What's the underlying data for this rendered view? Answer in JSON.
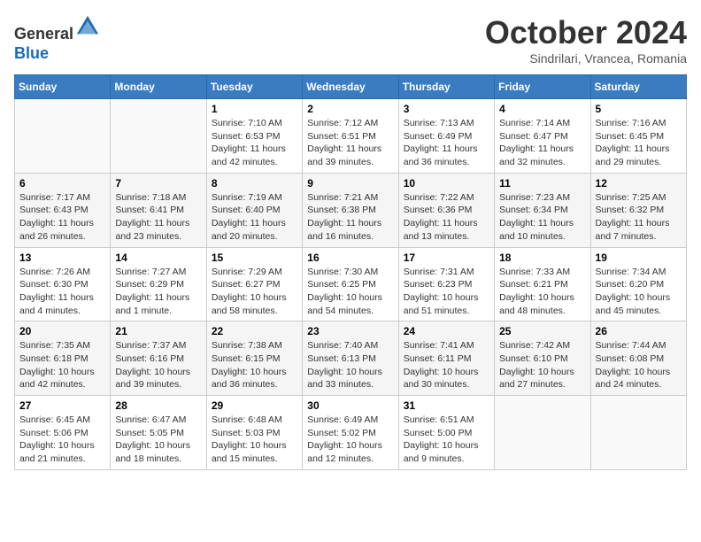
{
  "header": {
    "logo_general": "General",
    "logo_blue": "Blue",
    "month_title": "October 2024",
    "subtitle": "Sindrilari, Vrancea, Romania"
  },
  "days_of_week": [
    "Sunday",
    "Monday",
    "Tuesday",
    "Wednesday",
    "Thursday",
    "Friday",
    "Saturday"
  ],
  "weeks": [
    [
      {
        "day": "",
        "sunrise": "",
        "sunset": "",
        "daylight": ""
      },
      {
        "day": "",
        "sunrise": "",
        "sunset": "",
        "daylight": ""
      },
      {
        "day": "1",
        "sunrise": "Sunrise: 7:10 AM",
        "sunset": "Sunset: 6:53 PM",
        "daylight": "Daylight: 11 hours and 42 minutes."
      },
      {
        "day": "2",
        "sunrise": "Sunrise: 7:12 AM",
        "sunset": "Sunset: 6:51 PM",
        "daylight": "Daylight: 11 hours and 39 minutes."
      },
      {
        "day": "3",
        "sunrise": "Sunrise: 7:13 AM",
        "sunset": "Sunset: 6:49 PM",
        "daylight": "Daylight: 11 hours and 36 minutes."
      },
      {
        "day": "4",
        "sunrise": "Sunrise: 7:14 AM",
        "sunset": "Sunset: 6:47 PM",
        "daylight": "Daylight: 11 hours and 32 minutes."
      },
      {
        "day": "5",
        "sunrise": "Sunrise: 7:16 AM",
        "sunset": "Sunset: 6:45 PM",
        "daylight": "Daylight: 11 hours and 29 minutes."
      }
    ],
    [
      {
        "day": "6",
        "sunrise": "Sunrise: 7:17 AM",
        "sunset": "Sunset: 6:43 PM",
        "daylight": "Daylight: 11 hours and 26 minutes."
      },
      {
        "day": "7",
        "sunrise": "Sunrise: 7:18 AM",
        "sunset": "Sunset: 6:41 PM",
        "daylight": "Daylight: 11 hours and 23 minutes."
      },
      {
        "day": "8",
        "sunrise": "Sunrise: 7:19 AM",
        "sunset": "Sunset: 6:40 PM",
        "daylight": "Daylight: 11 hours and 20 minutes."
      },
      {
        "day": "9",
        "sunrise": "Sunrise: 7:21 AM",
        "sunset": "Sunset: 6:38 PM",
        "daylight": "Daylight: 11 hours and 16 minutes."
      },
      {
        "day": "10",
        "sunrise": "Sunrise: 7:22 AM",
        "sunset": "Sunset: 6:36 PM",
        "daylight": "Daylight: 11 hours and 13 minutes."
      },
      {
        "day": "11",
        "sunrise": "Sunrise: 7:23 AM",
        "sunset": "Sunset: 6:34 PM",
        "daylight": "Daylight: 11 hours and 10 minutes."
      },
      {
        "day": "12",
        "sunrise": "Sunrise: 7:25 AM",
        "sunset": "Sunset: 6:32 PM",
        "daylight": "Daylight: 11 hours and 7 minutes."
      }
    ],
    [
      {
        "day": "13",
        "sunrise": "Sunrise: 7:26 AM",
        "sunset": "Sunset: 6:30 PM",
        "daylight": "Daylight: 11 hours and 4 minutes."
      },
      {
        "day": "14",
        "sunrise": "Sunrise: 7:27 AM",
        "sunset": "Sunset: 6:29 PM",
        "daylight": "Daylight: 11 hours and 1 minute."
      },
      {
        "day": "15",
        "sunrise": "Sunrise: 7:29 AM",
        "sunset": "Sunset: 6:27 PM",
        "daylight": "Daylight: 10 hours and 58 minutes."
      },
      {
        "day": "16",
        "sunrise": "Sunrise: 7:30 AM",
        "sunset": "Sunset: 6:25 PM",
        "daylight": "Daylight: 10 hours and 54 minutes."
      },
      {
        "day": "17",
        "sunrise": "Sunrise: 7:31 AM",
        "sunset": "Sunset: 6:23 PM",
        "daylight": "Daylight: 10 hours and 51 minutes."
      },
      {
        "day": "18",
        "sunrise": "Sunrise: 7:33 AM",
        "sunset": "Sunset: 6:21 PM",
        "daylight": "Daylight: 10 hours and 48 minutes."
      },
      {
        "day": "19",
        "sunrise": "Sunrise: 7:34 AM",
        "sunset": "Sunset: 6:20 PM",
        "daylight": "Daylight: 10 hours and 45 minutes."
      }
    ],
    [
      {
        "day": "20",
        "sunrise": "Sunrise: 7:35 AM",
        "sunset": "Sunset: 6:18 PM",
        "daylight": "Daylight: 10 hours and 42 minutes."
      },
      {
        "day": "21",
        "sunrise": "Sunrise: 7:37 AM",
        "sunset": "Sunset: 6:16 PM",
        "daylight": "Daylight: 10 hours and 39 minutes."
      },
      {
        "day": "22",
        "sunrise": "Sunrise: 7:38 AM",
        "sunset": "Sunset: 6:15 PM",
        "daylight": "Daylight: 10 hours and 36 minutes."
      },
      {
        "day": "23",
        "sunrise": "Sunrise: 7:40 AM",
        "sunset": "Sunset: 6:13 PM",
        "daylight": "Daylight: 10 hours and 33 minutes."
      },
      {
        "day": "24",
        "sunrise": "Sunrise: 7:41 AM",
        "sunset": "Sunset: 6:11 PM",
        "daylight": "Daylight: 10 hours and 30 minutes."
      },
      {
        "day": "25",
        "sunrise": "Sunrise: 7:42 AM",
        "sunset": "Sunset: 6:10 PM",
        "daylight": "Daylight: 10 hours and 27 minutes."
      },
      {
        "day": "26",
        "sunrise": "Sunrise: 7:44 AM",
        "sunset": "Sunset: 6:08 PM",
        "daylight": "Daylight: 10 hours and 24 minutes."
      }
    ],
    [
      {
        "day": "27",
        "sunrise": "Sunrise: 6:45 AM",
        "sunset": "Sunset: 5:06 PM",
        "daylight": "Daylight: 10 hours and 21 minutes."
      },
      {
        "day": "28",
        "sunrise": "Sunrise: 6:47 AM",
        "sunset": "Sunset: 5:05 PM",
        "daylight": "Daylight: 10 hours and 18 minutes."
      },
      {
        "day": "29",
        "sunrise": "Sunrise: 6:48 AM",
        "sunset": "Sunset: 5:03 PM",
        "daylight": "Daylight: 10 hours and 15 minutes."
      },
      {
        "day": "30",
        "sunrise": "Sunrise: 6:49 AM",
        "sunset": "Sunset: 5:02 PM",
        "daylight": "Daylight: 10 hours and 12 minutes."
      },
      {
        "day": "31",
        "sunrise": "Sunrise: 6:51 AM",
        "sunset": "Sunset: 5:00 PM",
        "daylight": "Daylight: 10 hours and 9 minutes."
      },
      {
        "day": "",
        "sunrise": "",
        "sunset": "",
        "daylight": ""
      },
      {
        "day": "",
        "sunrise": "",
        "sunset": "",
        "daylight": ""
      }
    ]
  ]
}
